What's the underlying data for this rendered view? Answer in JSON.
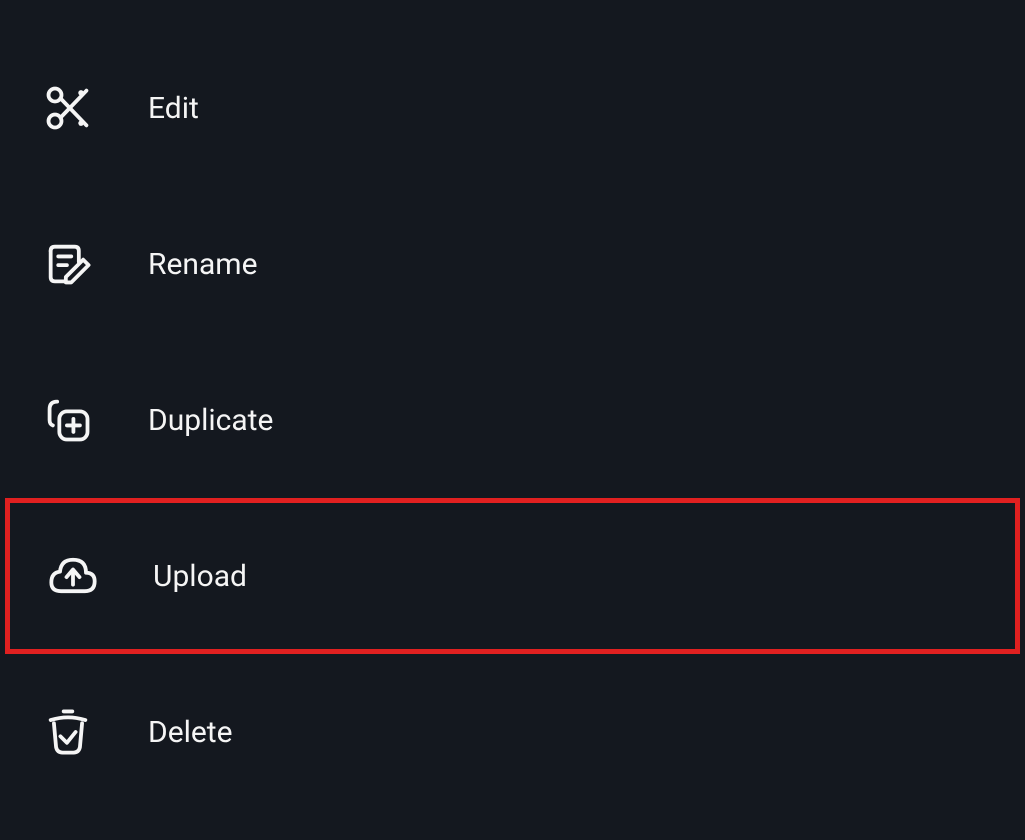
{
  "menu": {
    "items": [
      {
        "label": "Edit",
        "highlighted": false
      },
      {
        "label": "Rename",
        "highlighted": false
      },
      {
        "label": "Duplicate",
        "highlighted": false
      },
      {
        "label": "Upload",
        "highlighted": true
      },
      {
        "label": "Delete",
        "highlighted": false
      }
    ]
  }
}
